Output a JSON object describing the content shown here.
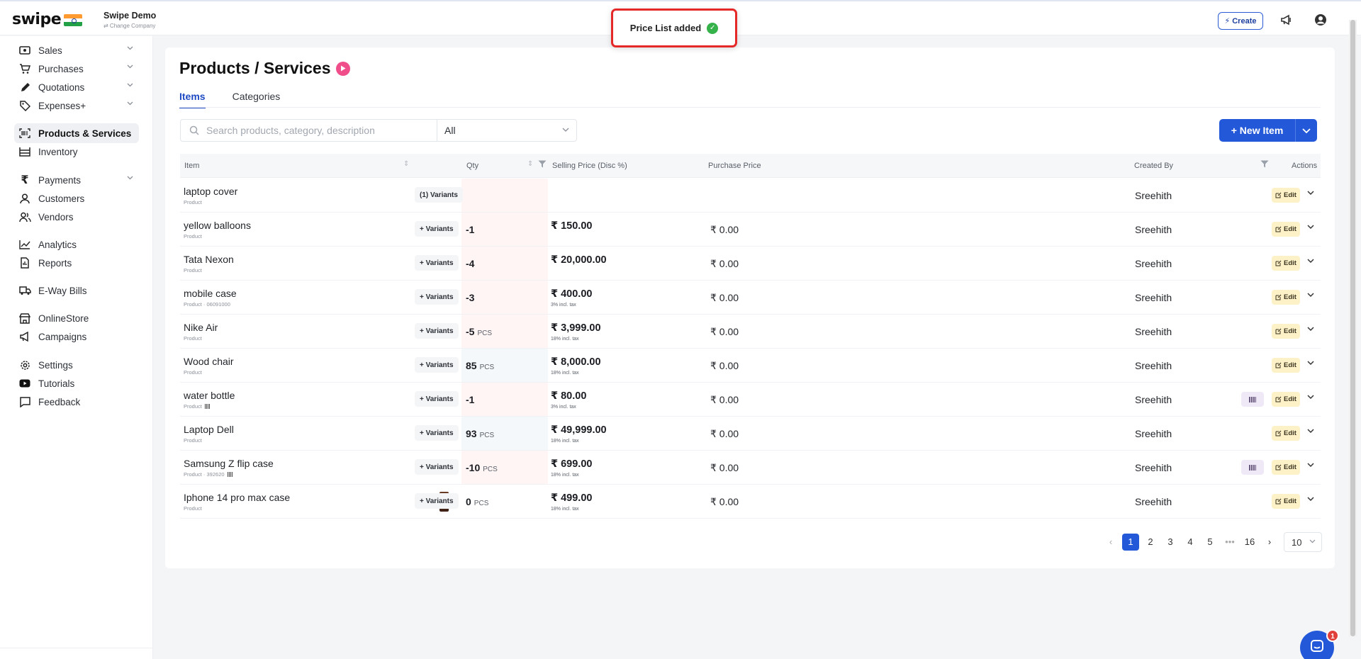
{
  "app": {
    "logo": "swipe",
    "company_name": "Swipe Demo",
    "change_company": "⇄ Change Company",
    "create_label": "Create"
  },
  "toast": {
    "text": "Price List added"
  },
  "sidebar": {
    "items": [
      {
        "label": "Sales",
        "icon": "wallet-icon",
        "chevron": true
      },
      {
        "label": "Purchases",
        "icon": "cart-icon",
        "chevron": true
      },
      {
        "label": "Quotations",
        "icon": "pen-icon",
        "chevron": true
      },
      {
        "label": "Expenses+",
        "icon": "tag-icon",
        "chevron": true
      },
      {
        "label": "Products & Services",
        "icon": "barcode-icon",
        "active": true
      },
      {
        "label": "Inventory",
        "icon": "warehouse-icon"
      },
      {
        "label": "Payments",
        "icon": "rupee-icon",
        "chevron": true
      },
      {
        "label": "Customers",
        "icon": "user-icon"
      },
      {
        "label": "Vendors",
        "icon": "users-icon"
      },
      {
        "label": "Analytics",
        "icon": "chart-icon"
      },
      {
        "label": "Reports",
        "icon": "report-icon"
      },
      {
        "label": "E-Way Bills",
        "icon": "truck-icon"
      },
      {
        "label": "OnlineStore",
        "icon": "store-icon"
      },
      {
        "label": "Campaigns",
        "icon": "megaphone-icon"
      },
      {
        "label": "Settings",
        "icon": "gear-icon"
      },
      {
        "label": "Tutorials",
        "icon": "youtube-icon"
      },
      {
        "label": "Feedback",
        "icon": "message-icon"
      }
    ]
  },
  "page": {
    "title": "Products / Services"
  },
  "tabs": [
    {
      "label": "Items",
      "active": true
    },
    {
      "label": "Categories"
    }
  ],
  "search": {
    "placeholder": "Search products, category, description"
  },
  "filter": {
    "selected": "All"
  },
  "new_item": {
    "label": "+ New Item"
  },
  "table": {
    "headers": {
      "item": "Item",
      "qty": "Qty",
      "selling": "Selling Price (Disc %)",
      "purchase": "Purchase Price",
      "created_by": "Created By",
      "actions": "Actions"
    },
    "variants_label": "Variants",
    "edit_label": "Edit",
    "rows": [
      {
        "name": "laptop cover",
        "sub": "Product",
        "variants": "(1) Variants",
        "qty": "",
        "unit": "",
        "price": "",
        "tax": "",
        "purchase": "",
        "created_by": "Sreehith",
        "qty_tint": "red"
      },
      {
        "name": "yellow balloons",
        "sub": "Product",
        "variants": "+ Variants",
        "qty": "-1",
        "unit": "",
        "price": "₹ 150.00",
        "tax": "",
        "purchase": "₹ 0.00",
        "created_by": "Sreehith",
        "qty_tint": "red"
      },
      {
        "name": "Tata Nexon",
        "sub": "Product",
        "variants": "+ Variants",
        "qty": "-4",
        "unit": "",
        "price": "₹ 20,000.00",
        "tax": "",
        "purchase": "₹ 0.00",
        "created_by": "Sreehith",
        "qty_tint": "red"
      },
      {
        "name": "mobile case",
        "sub": "Product · 06091000",
        "variants": "+ Variants",
        "qty": "-3",
        "unit": "",
        "price": "₹ 400.00",
        "tax": "3% incl. tax",
        "purchase": "₹ 0.00",
        "created_by": "Sreehith",
        "qty_tint": "red"
      },
      {
        "name": "Nike Air",
        "sub": "Product",
        "variants": "+ Variants",
        "qty": "-5",
        "unit": "PCS",
        "price": "₹ 3,999.00",
        "tax": "18% incl. tax",
        "purchase": "₹ 0.00",
        "created_by": "Sreehith",
        "qty_tint": "red"
      },
      {
        "name": "Wood chair",
        "sub": "Product",
        "variants": "+ Variants",
        "qty": "85",
        "unit": "PCS",
        "price": "₹ 8,000.00",
        "tax": "18% incl. tax",
        "purchase": "₹ 0.00",
        "created_by": "Sreehith",
        "qty_tint": "blue"
      },
      {
        "name": "water bottle",
        "sub": "Product",
        "barcode": true,
        "variants": "+ Variants",
        "qty": "-1",
        "unit": "",
        "price": "₹ 80.00",
        "tax": "3% incl. tax",
        "purchase": "₹ 0.00",
        "created_by": "Sreehith",
        "qty_tint": "red",
        "barcode_btn": true
      },
      {
        "name": "Laptop Dell",
        "sub": "Product",
        "variants": "+ Variants",
        "qty": "93",
        "unit": "PCS",
        "price": "₹ 49,999.00",
        "tax": "18% incl. tax",
        "purchase": "₹ 0.00",
        "created_by": "Sreehith",
        "qty_tint": "blue"
      },
      {
        "name": "Samsung Z flip case",
        "sub": "Product · 392620",
        "barcode": true,
        "variants": "+ Variants",
        "qty": "-10",
        "unit": "PCS",
        "price": "₹ 699.00",
        "tax": "18% incl. tax",
        "purchase": "₹ 0.00",
        "created_by": "Sreehith",
        "qty_tint": "red",
        "barcode_btn": true
      },
      {
        "name": "Iphone 14 pro max case",
        "sub": "Product",
        "thumb": true,
        "variants": "+ Variants",
        "qty": "0",
        "unit": "PCS",
        "price": "₹ 499.00",
        "tax": "18% incl. tax",
        "purchase": "₹ 0.00",
        "created_by": "Sreehith",
        "qty_tint": "none"
      }
    ]
  },
  "pagination": {
    "pages": [
      "1",
      "2",
      "3",
      "4",
      "5",
      "•••",
      "16"
    ],
    "current": "1",
    "page_size": "10"
  },
  "chat": {
    "badge": "1"
  },
  "colors": {
    "primary": "#2359d9",
    "toast_border": "#e52828",
    "success": "#36b24a",
    "edit_bg": "#fdf1c8",
    "qty_negative_tint": "#fff5f5",
    "qty_positive_tint": "#f4f8fb"
  }
}
